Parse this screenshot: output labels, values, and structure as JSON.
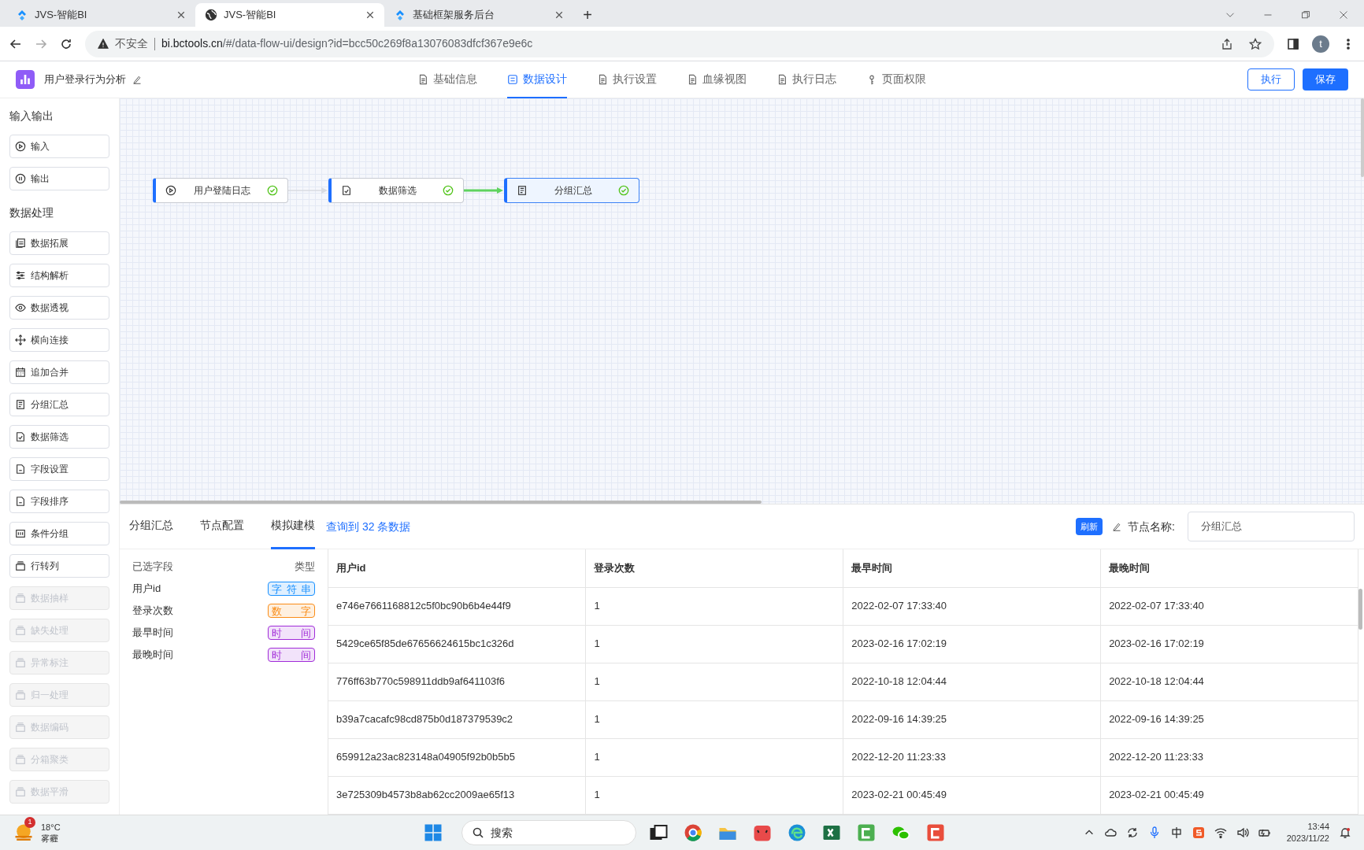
{
  "browser": {
    "tabs": [
      {
        "title": "JVS-智能BI",
        "selected": false
      },
      {
        "title": "JVS-智能BI",
        "selected": true
      },
      {
        "title": "基础框架服务后台",
        "selected": false
      }
    ],
    "security": "不安全",
    "url_host": "bi.bctools.cn",
    "url_path": "/#/data-flow-ui/design?id=bcc50c269f8a13076083dfcf367e9e6c",
    "profile": "t",
    "new_tab": "+"
  },
  "header": {
    "title": "用户登录行为分析",
    "nav": [
      {
        "label": "基础信息",
        "selected": false
      },
      {
        "label": "数据设计",
        "selected": true
      },
      {
        "label": "执行设置",
        "selected": false
      },
      {
        "label": "血缘视图",
        "selected": false
      },
      {
        "label": "执行日志",
        "selected": false
      },
      {
        "label": "页面权限",
        "selected": false
      }
    ],
    "buttons": [
      {
        "label": "执行",
        "kind": "outline"
      },
      {
        "label": "保存",
        "kind": "primary"
      }
    ]
  },
  "sidebar": {
    "groups": [
      {
        "title": "输入输出",
        "items": [
          {
            "label": "输入",
            "disabled": false
          },
          {
            "label": "输出",
            "disabled": false
          }
        ]
      },
      {
        "title": "数据处理",
        "items": [
          {
            "label": "数据拓展",
            "disabled": false
          },
          {
            "label": "结构解析",
            "disabled": false
          },
          {
            "label": "数据透视",
            "disabled": false
          },
          {
            "label": "横向连接",
            "disabled": false
          },
          {
            "label": "追加合并",
            "disabled": false
          },
          {
            "label": "分组汇总",
            "disabled": false
          },
          {
            "label": "数据筛选",
            "disabled": false
          },
          {
            "label": "字段设置",
            "disabled": false
          },
          {
            "label": "字段排序",
            "disabled": false
          },
          {
            "label": "条件分组",
            "disabled": false
          },
          {
            "label": "行转列",
            "disabled": false
          },
          {
            "label": "数据抽样",
            "disabled": true
          },
          {
            "label": "缺失处理",
            "disabled": true
          },
          {
            "label": "异常标注",
            "disabled": true
          },
          {
            "label": "归一处理",
            "disabled": true
          },
          {
            "label": "数据编码",
            "disabled": true
          },
          {
            "label": "分箱聚类",
            "disabled": true
          },
          {
            "label": "数据平滑",
            "disabled": true
          }
        ]
      }
    ]
  },
  "canvas": {
    "nodes": [
      {
        "label": "用户登陆日志",
        "selected": false
      },
      {
        "label": "数据筛选",
        "selected": false
      },
      {
        "label": "分组汇总",
        "selected": true
      }
    ],
    "edges": [
      {
        "active": false
      },
      {
        "active": true
      }
    ]
  },
  "panel": {
    "tabs": [
      {
        "label": "分组汇总",
        "selected": false
      },
      {
        "label": "节点配置",
        "selected": false
      },
      {
        "label": "模拟建模",
        "selected": true
      }
    ],
    "query_info": "查询到 32 条数据",
    "refresh": "刷新",
    "node_name_label": "节点名称:",
    "node_name": "分组汇总",
    "fields": {
      "header": [
        "已选字段",
        "类型"
      ],
      "rows": [
        {
          "name": "用户id",
          "type": "字符串",
          "color": "#1890ff"
        },
        {
          "name": "登录次数",
          "type": "数字",
          "color": "#fa8c16"
        },
        {
          "name": "最早时间",
          "type": "时间",
          "color": "#a12cd8"
        },
        {
          "name": "最晚时间",
          "type": "时间",
          "color": "#a12cd8"
        }
      ]
    },
    "table": {
      "columns": [
        "用户id",
        "登录次数",
        "最早时间",
        "最晚时间"
      ],
      "rows": [
        [
          "e746e7661168812c5f0bc90b6b4e44f9",
          "1",
          "2022-02-07 17:33:40",
          "2022-02-07 17:33:40"
        ],
        [
          "5429ce65f85de67656624615bc1c326d",
          "1",
          "2023-02-16 17:02:19",
          "2023-02-16 17:02:19"
        ],
        [
          "776ff63b770c598911ddb9af641103f6",
          "1",
          "2022-10-18 12:04:44",
          "2022-10-18 12:04:44"
        ],
        [
          "b39a7cacafc98cd875b0d187379539c2",
          "1",
          "2022-09-16 14:39:25",
          "2022-09-16 14:39:25"
        ],
        [
          "659912a23ac823148a04905f92b0b5b5",
          "1",
          "2022-12-20 11:23:33",
          "2022-12-20 11:23:33"
        ],
        [
          "3e725309b4573b8ab62cc2009ae65f13",
          "1",
          "2023-02-21 00:45:49",
          "2023-02-21 00:45:49"
        ]
      ]
    }
  },
  "taskbar": {
    "temperature": "18°C",
    "weather": "雾霾",
    "weather_badge": "1",
    "search": "搜索",
    "time": "13:44",
    "date": "2023/11/22"
  }
}
